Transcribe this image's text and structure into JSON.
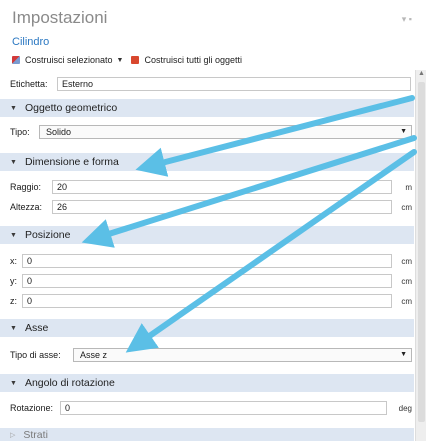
{
  "header": {
    "title": "Impostazioni",
    "subtitle": "Cilindro",
    "pin_icon": "pin-icon"
  },
  "toolbar": {
    "build_selected": "Costruisci selezionato",
    "build_all": "Costruisci tutti gli oggetti"
  },
  "label_field": {
    "label": "Etichetta:",
    "value": "Esterno"
  },
  "sections": {
    "geometric_object": "Oggetto geometrico",
    "size_shape": "Dimensione e forma",
    "position": "Posizione",
    "axis": "Asse",
    "rotation_angle": "Angolo di rotazione",
    "layers": "Strati"
  },
  "geometric_object": {
    "type_label": "Tipo:",
    "type_value": "Solido"
  },
  "size_shape": {
    "radius_label": "Raggio:",
    "radius_value": "20",
    "radius_unit": "m",
    "height_label": "Altezza:",
    "height_value": "26",
    "height_unit": "cm"
  },
  "position": {
    "x_label": "x:",
    "x_value": "0",
    "x_unit": "cm",
    "y_label": "y:",
    "y_value": "0",
    "y_unit": "cm",
    "z_label": "z:",
    "z_value": "0",
    "z_unit": "cm"
  },
  "axis": {
    "type_label": "Tipo di asse:",
    "type_value": "Asse z"
  },
  "rotation": {
    "label": "Rotazione:",
    "value": "0",
    "unit": "deg"
  },
  "colors": {
    "arrow": "#5bbfe6",
    "section_bg": "#dde6f2",
    "link": "#2b78c2"
  }
}
